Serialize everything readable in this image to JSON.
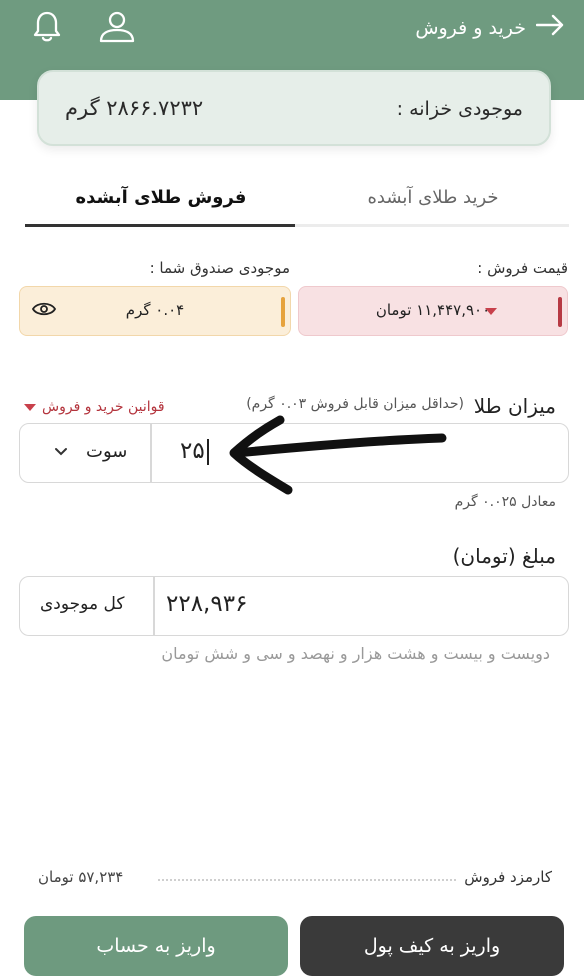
{
  "header": {
    "title": "خرید و فروش",
    "back_icon": "arrow-right-icon",
    "icons": [
      "bell-icon",
      "user-icon"
    ]
  },
  "treasury": {
    "label": "موجودی خزانه :",
    "value": "۲۸۶۶.۷۲۳۲ گرم"
  },
  "tabs": {
    "buy": "خرید طلای آبشده",
    "sell": "فروش طلای آبشده",
    "active": "sell"
  },
  "sell_price": {
    "label": "قیمت فروش :",
    "value": "۱۱,۴۴۷,۹۰۰ تومان"
  },
  "wallet_balance": {
    "label": "موجودی صندوق شما :",
    "value": "۰.۰۴ گرم"
  },
  "gold_amount": {
    "title": "میزان طلا",
    "hint": "(حداقل میزان قابل فروش ۰.۰۳ گرم)",
    "rules_link": "قوانین خرید و فروش",
    "value": "۲۵",
    "unit": "سوت",
    "equivalent": "معادل ۰.۰۲۵ گرم"
  },
  "amount": {
    "title": "مبلغ (تومان)",
    "value": "۲۲۸,۹۳۶",
    "all_balance_button": "کل موجودی",
    "in_words": "دویست و بیست و هشت هزار و نهصد و سی و شش تومان"
  },
  "fee": {
    "label": "کارمزد فروش",
    "value": "۵۷,۲۳۴ تومان"
  },
  "buttons": {
    "deposit_wallet": "واریز به کیف پول",
    "deposit_account": "واریز به حساب"
  },
  "colors": {
    "header": "#6f9b80",
    "price_bg": "#f8e1e3",
    "price_accent": "#b73a44",
    "balance_bg": "#fbeed9",
    "balance_accent": "#e6a33e",
    "primary_button": "#3a3a3a",
    "secondary_button": "#6e9a7f"
  }
}
